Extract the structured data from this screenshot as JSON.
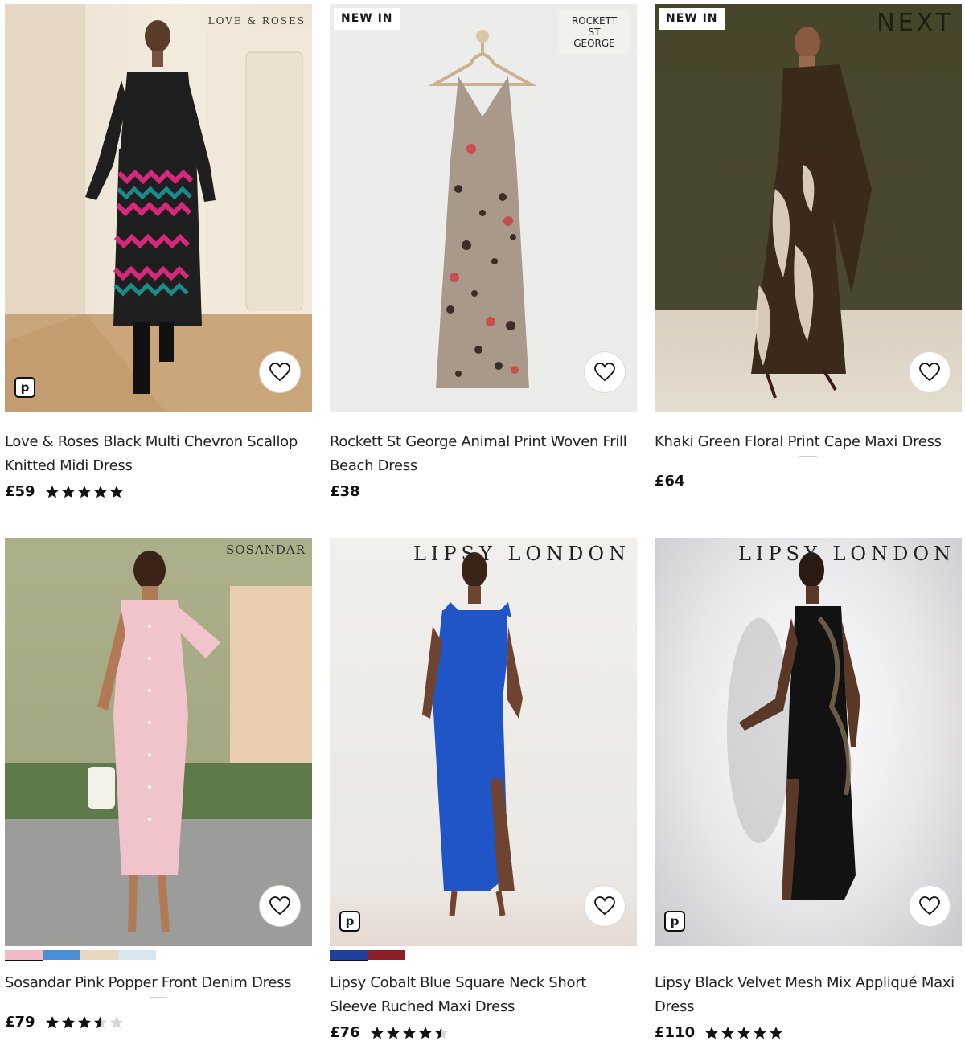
{
  "products": [
    {
      "brand": "LOVE & ROSES",
      "badge": "",
      "name": "Love & Roses Black Multi Chevron Scallop Knitted Midi Dress",
      "price": "£59",
      "rating": 5,
      "pay_icon": "p",
      "swatches": [],
      "image_desc_colors": {
        "bg": "#efe6d6",
        "floor": "#c9a77a",
        "dress": "#1f1f1f"
      }
    },
    {
      "brand": "ROCKETT ST GEORGE",
      "badge": "NEW IN",
      "name": "Rockett St George Animal Print Woven Frill Beach Dress",
      "price": "£38",
      "rating": 0,
      "pay_icon": "",
      "swatches": []
    },
    {
      "brand": "NEXT",
      "badge": "NEW IN",
      "name": "Khaki Green Floral Print Cape Maxi Dress",
      "price": "£64",
      "rating": 0,
      "pay_icon": "",
      "swatches": []
    },
    {
      "brand": "SOSANDAR",
      "badge": "",
      "name": "Sosandar Pink Popper Front Denim Dress",
      "price": "£79",
      "rating": 3.5,
      "pay_icon": "",
      "swatches": [
        "#f2b9c6",
        "#4a8fd6",
        "#e8d8bf",
        "#d9e6ef"
      ]
    },
    {
      "brand": "LIPSY LONDON",
      "badge": "",
      "name": "Lipsy Cobalt Blue Square Neck Short Sleeve Ruched Maxi Dress",
      "price": "£76",
      "rating": 4.5,
      "pay_icon": "p",
      "swatches": [
        "#1f3f9c",
        "#8a1f2a"
      ]
    },
    {
      "brand": "LIPSY LONDON",
      "badge": "",
      "name": "Lipsy Black Velvet Mesh Mix Appliqué Maxi Dress",
      "price": "£110",
      "rating": 5,
      "pay_icon": "p",
      "swatches": []
    }
  ],
  "colors": {
    "star": "#111111",
    "star_empty": "#d6d6d6",
    "text": "#222222"
  }
}
